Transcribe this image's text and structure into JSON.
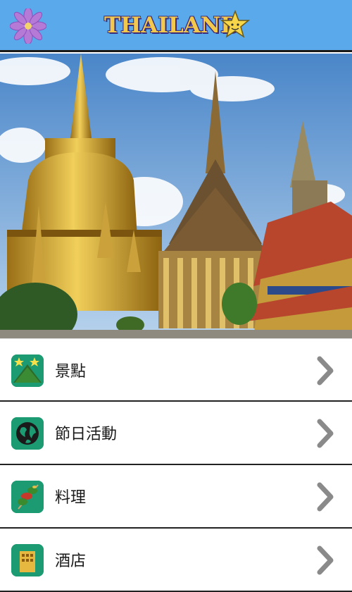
{
  "header": {
    "title": "THAILAND",
    "menu_icon": "purple-flower-icon",
    "title_icon": "star-icon",
    "colors": {
      "background": "#5aa9ea",
      "title": "#f2c94c",
      "title_outline": "#3a2a7c"
    }
  },
  "hero": {
    "image": "temple-photo"
  },
  "menu": {
    "items": [
      {
        "label": "景點",
        "icon": "mountain-stars-icon"
      },
      {
        "label": "節日活動",
        "icon": "globe-icon"
      },
      {
        "label": "料理",
        "icon": "skewer-food-icon"
      },
      {
        "label": "酒店",
        "icon": "hotel-building-icon"
      }
    ],
    "chevron_icon": "chevron-right-icon",
    "colors": {
      "icon_bg": "#1c9a72",
      "chevron": "#8a8a8a"
    }
  }
}
